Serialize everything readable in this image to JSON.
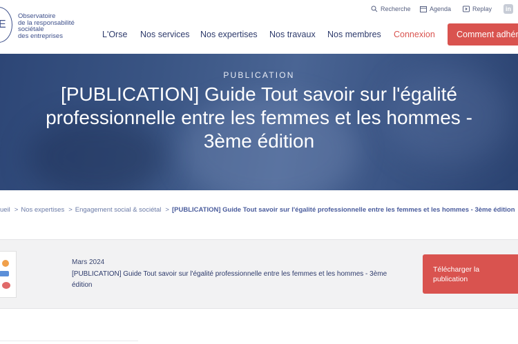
{
  "logo": {
    "letter": "E",
    "lines": [
      "Observatoire",
      "de la responsabilité",
      "sociétale",
      "des entreprises"
    ]
  },
  "utility": {
    "search": "Recherche",
    "agenda": "Agenda",
    "replay": "Replay",
    "linkedin": "in"
  },
  "nav": {
    "items": [
      "L'Orse",
      "Nos services",
      "Nos expertises",
      "Nos travaux",
      "Nos membres"
    ],
    "login": "Connexion",
    "cta": "Comment adhérer"
  },
  "hero": {
    "tag": "PUBLICATION",
    "title": "[PUBLICATION] Guide Tout savoir sur l'égalité professionnelle entre les femmes et les hommes - 3ème édition"
  },
  "breadcrumb": {
    "items": [
      "ueil",
      "Nos expertises",
      "Engagement social & sociétal"
    ],
    "separator": ">",
    "current": "[PUBLICATION] Guide Tout savoir sur l'égalité professionnelle entre les femmes et les hommes - 3ème édition"
  },
  "publication": {
    "date": "Mars 2024",
    "title": "[PUBLICATION] Guide Tout savoir sur l'égalité professionnelle entre les femmes et les hommes - 3ème édition",
    "download_label": "Télécharger la publication"
  },
  "colors": {
    "brand": "#2d3a6b",
    "accent": "#d9534f"
  }
}
